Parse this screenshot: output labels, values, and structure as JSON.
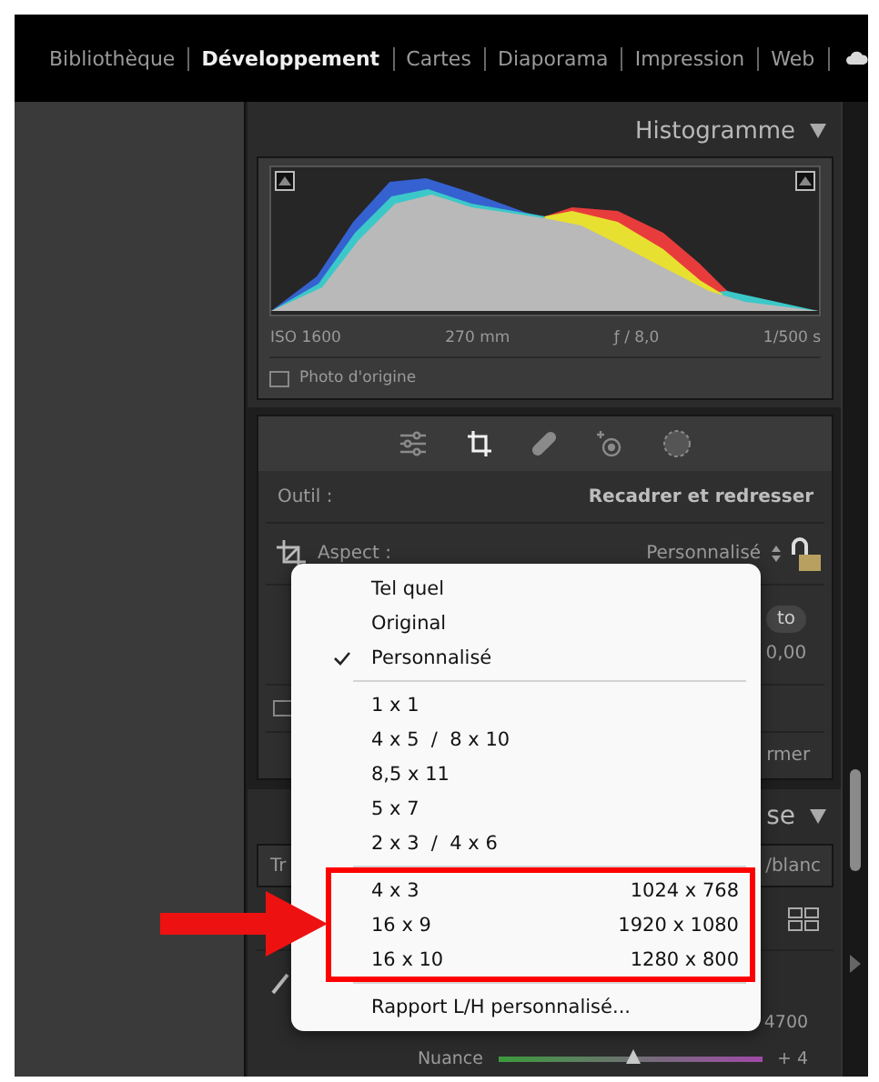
{
  "modules": [
    {
      "label": "Bibliothèque",
      "selected": false
    },
    {
      "label": "Développement",
      "selected": true
    },
    {
      "label": "Cartes",
      "selected": false
    },
    {
      "label": "Diaporama",
      "selected": false
    },
    {
      "label": "Impression",
      "selected": false
    },
    {
      "label": "Web",
      "selected": false
    }
  ],
  "histogram": {
    "title": "Histogramme",
    "iso": "ISO 1600",
    "focal": "270 mm",
    "aperture": "ƒ / 8,0",
    "shutter": "1/500 s",
    "original_photo": {
      "label": "Photo d'origine",
      "checked": false
    }
  },
  "tools": [
    {
      "kind": "sliders",
      "selected": false
    },
    {
      "kind": "crop",
      "selected": true
    },
    {
      "kind": "heal",
      "selected": false
    },
    {
      "kind": "redeye",
      "selected": false
    },
    {
      "kind": "mask",
      "selected": false
    }
  ],
  "crop": {
    "tool_label": "Outil :",
    "tool_name": "Recadrer et redresser",
    "aspect_label": "Aspect :",
    "aspect_value": "Personnalisé",
    "locked": false,
    "grid_checked": false,
    "auto_button": "to",
    "angle_value": "0,00",
    "close_button": "rmer"
  },
  "basic": {
    "title": "se",
    "tab_left": "Tr",
    "tab_right": "/blanc",
    "temp_value": "4700",
    "tint_label": "Nuance",
    "tint_value": "+ 4",
    "tint": {
      "level": 0.51
    }
  },
  "aspect_menu": {
    "groups": [
      {
        "highlighted": false,
        "items": [
          {
            "label": "Tel quel",
            "selected": false
          },
          {
            "label": "Original",
            "selected": false
          },
          {
            "label": "Personnalisé",
            "selected": true
          }
        ]
      },
      {
        "highlighted": false,
        "items": [
          {
            "label": "1 x 1",
            "selected": false
          },
          {
            "label": "4 x 5  /  8 x 10",
            "selected": false
          },
          {
            "label": "8,5 x 11",
            "selected": false
          },
          {
            "label": "5 x 7",
            "selected": false
          },
          {
            "label": "2 x 3  /  4 x 6",
            "selected": false
          }
        ]
      },
      {
        "highlighted": true,
        "items": [
          {
            "label": "4 x 3",
            "size": "1024 x 768",
            "selected": false
          },
          {
            "label": "16 x 9",
            "size": "1920 x 1080",
            "selected": false
          },
          {
            "label": "16 x 10",
            "size": "1280 x 800",
            "selected": false
          }
        ]
      },
      {
        "highlighted": false,
        "items": [
          {
            "label": "Rapport L/H personnalisé...",
            "selected": false
          }
        ]
      }
    ]
  }
}
